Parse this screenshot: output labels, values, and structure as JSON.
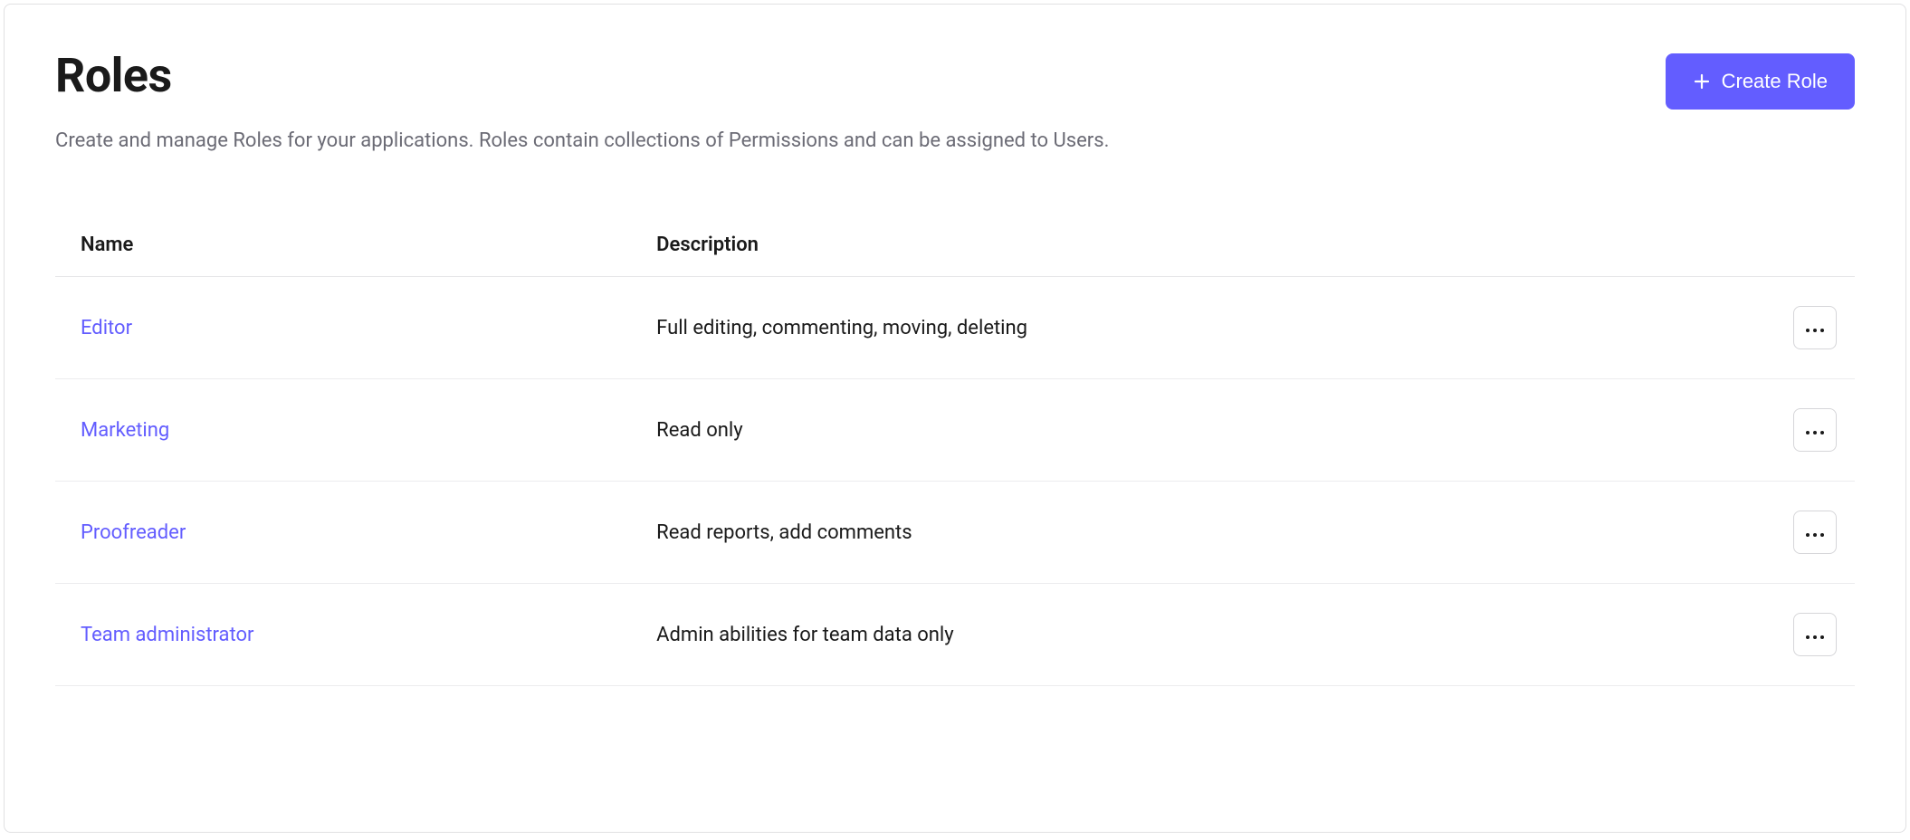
{
  "header": {
    "title": "Roles",
    "create_label": "Create Role",
    "subtitle": "Create and manage Roles for your applications. Roles contain collections of Permissions and can be assigned to Users."
  },
  "table": {
    "columns": {
      "name": "Name",
      "description": "Description"
    },
    "rows": [
      {
        "name": "Editor",
        "description": "Full editing, commenting, moving, deleting"
      },
      {
        "name": "Marketing",
        "description": "Read only"
      },
      {
        "name": "Proofreader",
        "description": "Read reports, add comments"
      },
      {
        "name": "Team administrator",
        "description": "Admin abilities for team data only"
      }
    ]
  },
  "colors": {
    "accent": "#635dff"
  }
}
